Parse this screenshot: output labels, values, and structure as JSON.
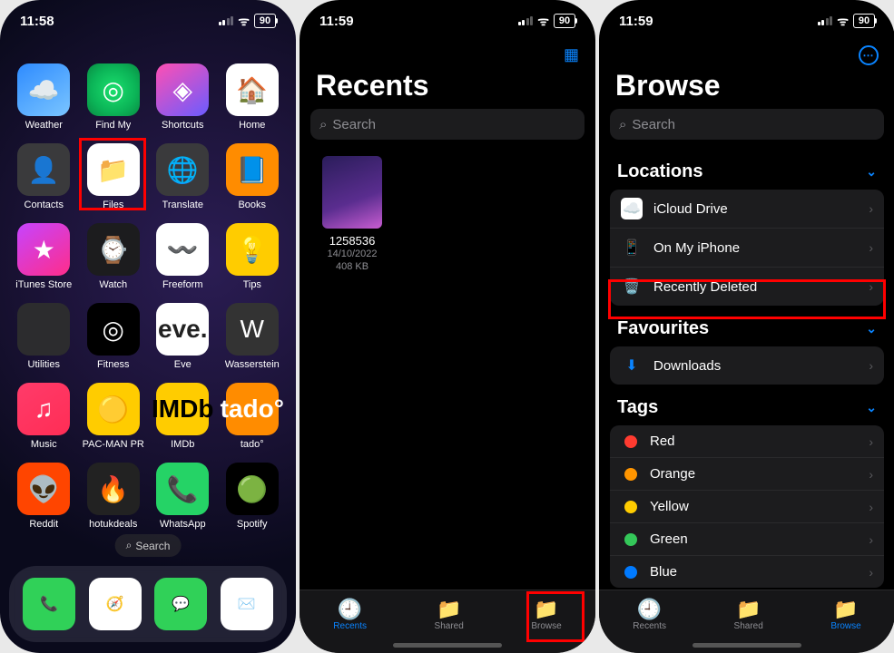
{
  "screen1": {
    "status": {
      "time": "11:58",
      "battery": "90"
    },
    "apps": [
      {
        "label": "Weather",
        "name": "weather-app",
        "cls": "bg-weather",
        "glyph": "☁️"
      },
      {
        "label": "Find My",
        "name": "find-my-app",
        "cls": "bg-findmy",
        "glyph": "◎"
      },
      {
        "label": "Shortcuts",
        "name": "shortcuts-app",
        "cls": "bg-short",
        "glyph": "◈"
      },
      {
        "label": "Home",
        "name": "home-app",
        "cls": "bg-home",
        "glyph": "🏠"
      },
      {
        "label": "Contacts",
        "name": "contacts-app",
        "cls": "bg-cont",
        "glyph": "👤"
      },
      {
        "label": "Files",
        "name": "files-app",
        "cls": "bg-files",
        "glyph": "📁"
      },
      {
        "label": "Translate",
        "name": "translate-app",
        "cls": "bg-trans",
        "glyph": "🌐"
      },
      {
        "label": "Books",
        "name": "books-app",
        "cls": "bg-books",
        "glyph": "📘"
      },
      {
        "label": "iTunes Store",
        "name": "itunes-app",
        "cls": "bg-itunes",
        "glyph": "★"
      },
      {
        "label": "Watch",
        "name": "watch-app",
        "cls": "bg-watch",
        "glyph": "⌚"
      },
      {
        "label": "Freeform",
        "name": "freeform-app",
        "cls": "bg-free",
        "glyph": "〰️"
      },
      {
        "label": "Tips",
        "name": "tips-app",
        "cls": "bg-tips",
        "glyph": "💡"
      },
      {
        "label": "Utilities",
        "name": "utilities-folder",
        "cls": "bg-util",
        "glyph": ""
      },
      {
        "label": "Fitness",
        "name": "fitness-app",
        "cls": "bg-fit",
        "glyph": "◎"
      },
      {
        "label": "Eve",
        "name": "eve-app",
        "cls": "bg-eve",
        "glyph": "eve."
      },
      {
        "label": "Wasserstein",
        "name": "wasserstein-app",
        "cls": "bg-wass",
        "glyph": "W"
      },
      {
        "label": "Music",
        "name": "music-app",
        "cls": "bg-music",
        "glyph": "♫"
      },
      {
        "label": "PAC-MAN PR",
        "name": "pacman-app",
        "cls": "bg-pac",
        "glyph": "🟡"
      },
      {
        "label": "IMDb",
        "name": "imdb-app",
        "cls": "bg-imdb",
        "glyph": "IMDb"
      },
      {
        "label": "tado°",
        "name": "tado-app",
        "cls": "bg-tado",
        "glyph": "tado°"
      },
      {
        "label": "Reddit",
        "name": "reddit-app",
        "cls": "bg-reddit",
        "glyph": "👽"
      },
      {
        "label": "hotukdeals",
        "name": "hotukdeals-app",
        "cls": "bg-hotuk",
        "glyph": "🔥"
      },
      {
        "label": "WhatsApp",
        "name": "whatsapp-app",
        "cls": "bg-wa",
        "glyph": "📞"
      },
      {
        "label": "Spotify",
        "name": "spotify-app",
        "cls": "bg-spot",
        "glyph": "🟢"
      }
    ],
    "spotlight": "Search",
    "dock": [
      {
        "name": "phone-app",
        "cls": "bg-phone",
        "glyph": "📞"
      },
      {
        "name": "safari-app",
        "cls": "bg-safari",
        "glyph": "🧭"
      },
      {
        "name": "messages-app",
        "cls": "bg-msg",
        "glyph": "💬"
      },
      {
        "name": "gmail-app",
        "cls": "bg-gmail",
        "glyph": "✉️"
      }
    ]
  },
  "screen2": {
    "status": {
      "time": "11:59",
      "battery": "90"
    },
    "title": "Recents",
    "search_placeholder": "Search",
    "file": {
      "name": "1258536",
      "date": "14/10/2022",
      "size": "408 KB"
    },
    "tabs": [
      {
        "label": "Recents",
        "name": "tab-recents",
        "glyph": "🕘",
        "active": true
      },
      {
        "label": "Shared",
        "name": "tab-shared",
        "glyph": "📁",
        "active": false
      },
      {
        "label": "Browse",
        "name": "tab-browse",
        "glyph": "📁",
        "active": false
      }
    ]
  },
  "screen3": {
    "status": {
      "time": "11:59",
      "battery": "90"
    },
    "title": "Browse",
    "search_placeholder": "Search",
    "sections": {
      "locations": {
        "header": "Locations",
        "rows": [
          {
            "label": "iCloud Drive",
            "name": "row-icloud-drive",
            "glyph": "☁️",
            "bg": "bg-icloud"
          },
          {
            "label": "On My iPhone",
            "name": "row-on-my-iphone",
            "glyph": "📱",
            "bg": ""
          },
          {
            "label": "Recently Deleted",
            "name": "row-recently-deleted",
            "glyph": "🗑️",
            "bg": ""
          }
        ]
      },
      "favourites": {
        "header": "Favourites",
        "rows": [
          {
            "label": "Downloads",
            "name": "row-downloads",
            "glyph": "⬇︎",
            "bg": ""
          }
        ]
      },
      "tags": {
        "header": "Tags",
        "rows": [
          {
            "label": "Red",
            "name": "tag-red",
            "color": "#ff3b30"
          },
          {
            "label": "Orange",
            "name": "tag-orange",
            "color": "#ff9500"
          },
          {
            "label": "Yellow",
            "name": "tag-yellow",
            "color": "#ffcc00"
          },
          {
            "label": "Green",
            "name": "tag-green",
            "color": "#34c759"
          },
          {
            "label": "Blue",
            "name": "tag-blue",
            "color": "#007aff"
          }
        ]
      }
    },
    "tabs": [
      {
        "label": "Recents",
        "name": "tab-recents",
        "glyph": "🕘",
        "active": false
      },
      {
        "label": "Shared",
        "name": "tab-shared",
        "glyph": "📁",
        "active": false
      },
      {
        "label": "Browse",
        "name": "tab-browse",
        "glyph": "📁",
        "active": true
      }
    ]
  }
}
